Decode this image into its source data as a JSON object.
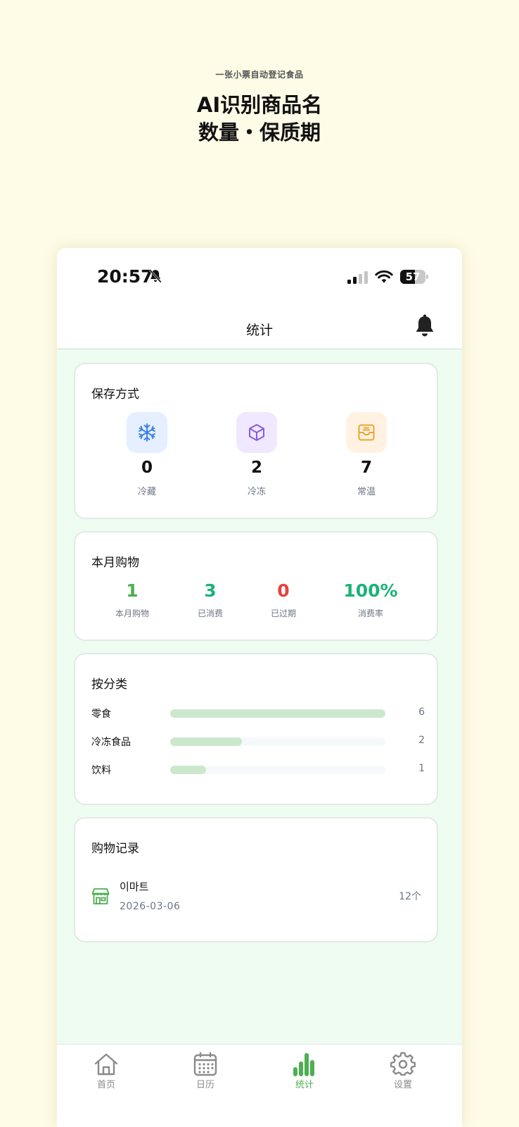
{
  "promo": {
    "subtitle": "一张小票自动登记食品",
    "title_line1": "AI识别商品名",
    "title_line2": "数量・保质期"
  },
  "status_bar": {
    "time": "20:57",
    "battery": "57",
    "battery_level": 0.57
  },
  "header": {
    "title": "统计"
  },
  "storage": {
    "title": "保存方式",
    "items": [
      {
        "icon": "snowflake-icon",
        "value": "0",
        "label": "冷藏",
        "bg": "#e5efff",
        "color": "#3f82e6"
      },
      {
        "icon": "cube-icon",
        "value": "2",
        "label": "冷冻",
        "bg": "#efe8fe",
        "color": "#8a5ae0"
      },
      {
        "icon": "inbox-icon",
        "value": "7",
        "label": "常温",
        "bg": "#fff2e2",
        "color": "#eba52f"
      }
    ]
  },
  "month": {
    "title": "本月购物",
    "items": [
      {
        "value": "1",
        "label": "本月购物",
        "color": "#4caf50"
      },
      {
        "value": "3",
        "label": "已消费",
        "color": "#1db278"
      },
      {
        "value": "0",
        "label": "已过期",
        "color": "#e8403c"
      },
      {
        "value": "100%",
        "label": "消费率",
        "color": "#1db278"
      }
    ]
  },
  "category": {
    "title": "按分类",
    "items": [
      {
        "name": "零食",
        "count": "6",
        "ratio": 1.0
      },
      {
        "name": "冷冻食品",
        "count": "2",
        "ratio": 0.333
      },
      {
        "name": "饮料",
        "count": "1",
        "ratio": 0.167
      }
    ]
  },
  "history": {
    "title": "购物记录",
    "records": [
      {
        "store": "이마트",
        "date": "2026-03-06",
        "count": "12个"
      }
    ]
  },
  "tabs": [
    {
      "label": "首页",
      "icon": "home-icon",
      "active": false
    },
    {
      "label": "日历",
      "icon": "calendar-icon",
      "active": false
    },
    {
      "label": "统计",
      "icon": "bar-chart-icon",
      "active": true
    },
    {
      "label": "设置",
      "icon": "settings-icon",
      "active": false
    }
  ],
  "colors": {
    "accent": "#4caf50",
    "background": "#fefbe7",
    "content_bg": "#effcf1"
  }
}
